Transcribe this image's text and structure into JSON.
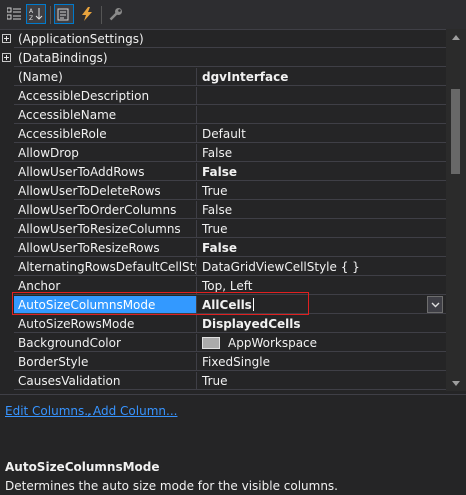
{
  "toolbar": {
    "buttons": [
      {
        "id": "categorized",
        "icon": "categorized-icon",
        "active": false
      },
      {
        "id": "alphabetical",
        "icon": "alphabetical-sort-icon",
        "active": true
      },
      {
        "id": "properties",
        "icon": "properties-icon",
        "active": true
      },
      {
        "id": "events",
        "icon": "lightning-events-icon",
        "active": false
      },
      {
        "id": "property-pages",
        "icon": "wrench-icon",
        "active": false
      }
    ]
  },
  "properties": {
    "rows": [
      {
        "name": "(ApplicationSettings)",
        "value": "",
        "category": true
      },
      {
        "name": "(DataBindings)",
        "value": "",
        "category": true
      },
      {
        "name": "(Name)",
        "value": "dgvInterface",
        "bold": true
      },
      {
        "name": "AccessibleDescription",
        "value": ""
      },
      {
        "name": "AccessibleName",
        "value": ""
      },
      {
        "name": "AccessibleRole",
        "value": "Default"
      },
      {
        "name": "AllowDrop",
        "value": "False"
      },
      {
        "name": "AllowUserToAddRows",
        "value": "False",
        "bold": true
      },
      {
        "name": "AllowUserToDeleteRows",
        "value": "True"
      },
      {
        "name": "AllowUserToOrderColumns",
        "value": "False"
      },
      {
        "name": "AllowUserToResizeColumns",
        "value": "True"
      },
      {
        "name": "AllowUserToResizeRows",
        "value": "False",
        "bold": true
      },
      {
        "name": "AlternatingRowsDefaultCellStyle",
        "value": "DataGridViewCellStyle { }"
      },
      {
        "name": "Anchor",
        "value": "Top, Left"
      },
      {
        "name": "AutoSizeColumnsMode",
        "value": "AllCells",
        "selected": true
      },
      {
        "name": "AutoSizeRowsMode",
        "value": "DisplayedCells",
        "bold": true
      },
      {
        "name": "BackgroundColor",
        "value": "AppWorkspace",
        "swatch": "#ababab"
      },
      {
        "name": "BorderStyle",
        "value": "FixedSingle"
      },
      {
        "name": "CausesValidation",
        "value": "True"
      }
    ]
  },
  "commands": {
    "edit_columns": "Edit Columns...",
    "separator": ",",
    "add_column": "Add Column..."
  },
  "description": {
    "title": "AutoSizeColumnsMode",
    "text": "Determines the auto size mode for the visible columns."
  },
  "colors": {
    "background": "#252526",
    "selection": "#3399ff",
    "link": "#3794ff",
    "highlight_border": "#e02020"
  }
}
